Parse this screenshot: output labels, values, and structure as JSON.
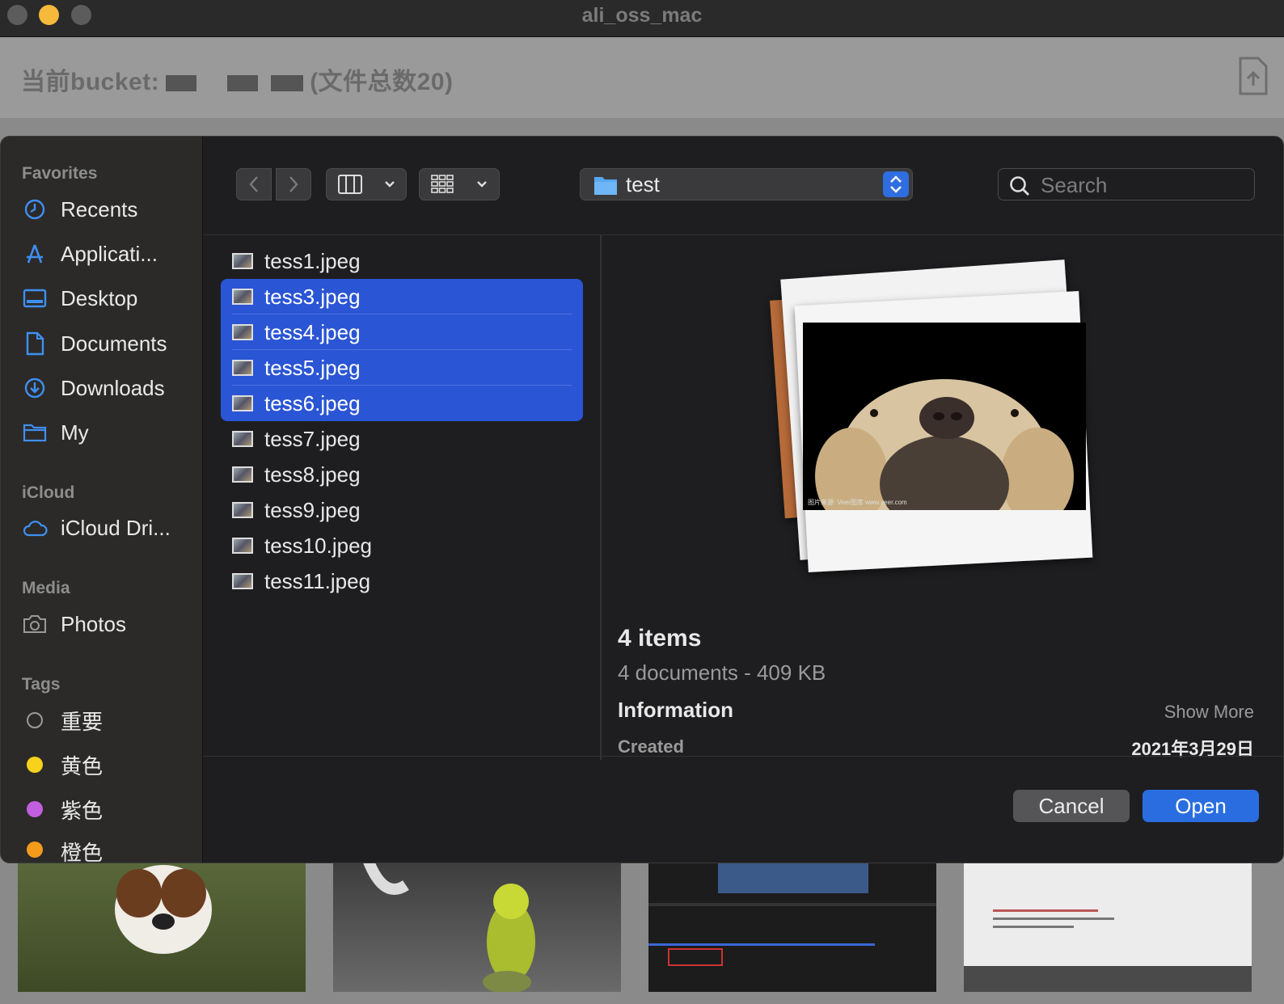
{
  "window": {
    "title": "ali_oss_mac"
  },
  "app": {
    "bucket_prefix": "当前bucket:",
    "bucket_suffix": "(文件总数20)"
  },
  "sidebar": {
    "favorites_title": "Favorites",
    "favorites": [
      {
        "label": "Recents",
        "icon": "clock-icon"
      },
      {
        "label": "Applicati...",
        "icon": "applications-icon"
      },
      {
        "label": "Desktop",
        "icon": "desktop-icon"
      },
      {
        "label": "Documents",
        "icon": "document-icon"
      },
      {
        "label": "Downloads",
        "icon": "download-icon"
      },
      {
        "label": "My",
        "icon": "folder-icon"
      }
    ],
    "icloud_title": "iCloud",
    "icloud": [
      {
        "label": "iCloud Dri...",
        "icon": "cloud-icon"
      }
    ],
    "media_title": "Media",
    "media": [
      {
        "label": "Photos",
        "icon": "camera-icon"
      }
    ],
    "tags_title": "Tags",
    "tags": [
      {
        "label": "重要",
        "color": "transparent"
      },
      {
        "label": "黄色",
        "color": "#f7d21a"
      },
      {
        "label": "紫色",
        "color": "#c25ee0"
      },
      {
        "label": "橙色",
        "color": "#f49b1c"
      }
    ]
  },
  "toolbar": {
    "folder_name": "test",
    "search_placeholder": "Search"
  },
  "files": [
    {
      "name": "tess1.jpeg",
      "selected": false
    },
    {
      "name": "tess3.jpeg",
      "selected": true
    },
    {
      "name": "tess4.jpeg",
      "selected": true
    },
    {
      "name": "tess5.jpeg",
      "selected": true
    },
    {
      "name": "tess6.jpeg",
      "selected": true
    },
    {
      "name": "tess7.jpeg",
      "selected": false
    },
    {
      "name": "tess8.jpeg",
      "selected": false
    },
    {
      "name": "tess9.jpeg",
      "selected": false
    },
    {
      "name": "tess10.jpeg",
      "selected": false
    },
    {
      "name": "tess11.jpeg",
      "selected": false
    }
  ],
  "preview": {
    "items_count": "4 items",
    "summary": "4 documents - 409 KB",
    "info_title": "Information",
    "show_more": "Show More",
    "created_label": "Created",
    "created_value": "2021年3月29日",
    "watermark": "图片来源: Veer图库 www.veer.com"
  },
  "buttons": {
    "cancel": "Cancel",
    "open": "Open"
  }
}
